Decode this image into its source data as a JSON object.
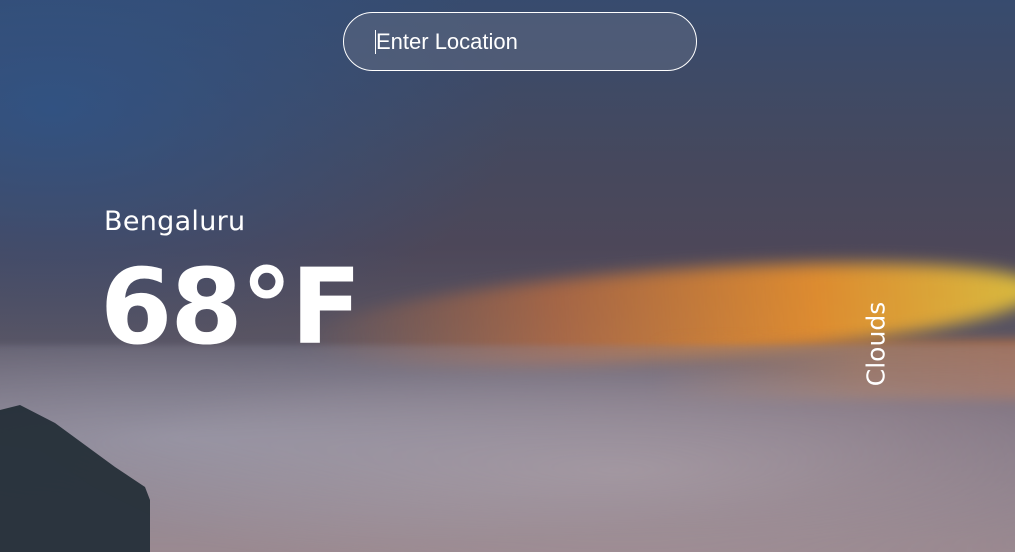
{
  "search": {
    "placeholder": "Enter Location",
    "value": ""
  },
  "weather": {
    "location": "Bengaluru",
    "temperature": "68°F",
    "condition": "Clouds"
  },
  "colors": {
    "text": "#ffffff",
    "search_border": "#ffffff",
    "sky_blue": "#3b4d6e",
    "sunset_orange": "#f0962a"
  }
}
